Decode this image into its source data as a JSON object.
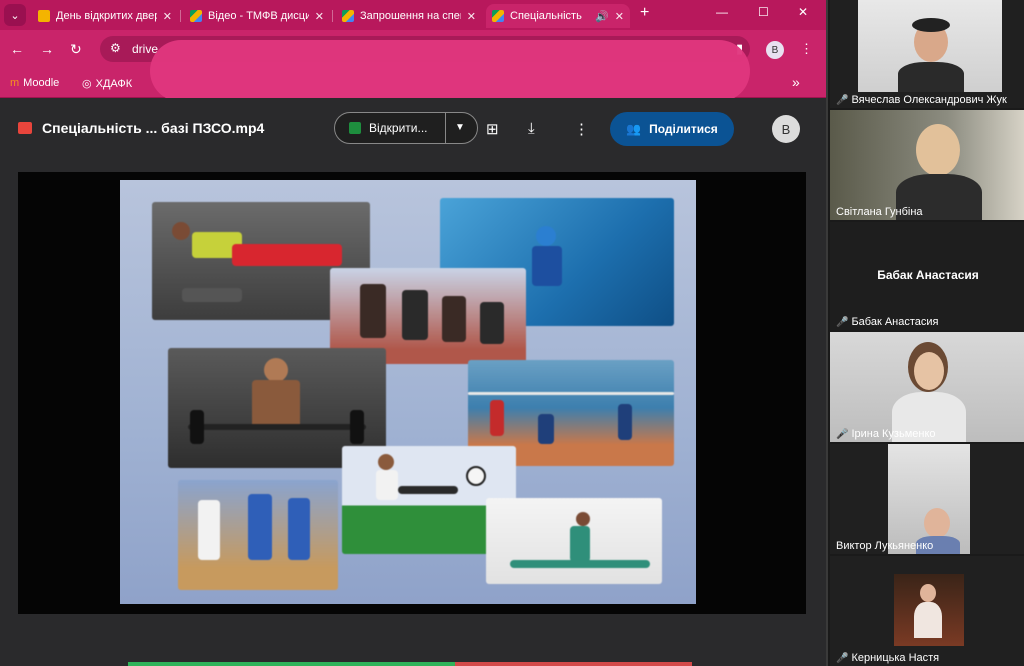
{
  "colors": {
    "tab_strip": "#b8185c",
    "toolbar": "#c9246a",
    "share_button": "#0b5394",
    "open_with_icon": "#1e8e3e",
    "mic_muted": "#e53935"
  },
  "browser": {
    "tabs": [
      {
        "title": "День відкритих дверей",
        "icon": "slides-icon",
        "active": false
      },
      {
        "title": "Відео - ТМФВ дисципліни",
        "icon": "drive-icon",
        "active": false
      },
      {
        "title": "Запрошення на спеціальність",
        "icon": "drive-icon",
        "active": false
      },
      {
        "title": "Спеціальність",
        "icon": "drive-icon",
        "active": true,
        "audio": "speaker-icon"
      }
    ],
    "url": "drive",
    "bookmarks": [
      {
        "label": "Moodle",
        "icon": "moodle-icon"
      },
      {
        "label": "ХДАФК",
        "icon": "globe-icon"
      }
    ],
    "profile_initial": "В"
  },
  "viewer": {
    "file_title": "Спеціальність ... базі ПЗСО.mp4",
    "open_with_label": "Відкрити...",
    "share_label": "Поділитися",
    "avatar_initial": "В"
  },
  "participants": [
    {
      "name": "Вячеслав Олександрович Жук",
      "muted": true,
      "video": true
    },
    {
      "name": "Світлана Гунбіна",
      "muted": false,
      "video": true
    },
    {
      "name": "Бабак Анастасия",
      "display_name": "Бабак Анастасия",
      "muted": true,
      "video": false
    },
    {
      "name": "Ірина Кузьменко",
      "muted": true,
      "video": true
    },
    {
      "name": "Виктор Лукьяненко",
      "muted": false,
      "video": true
    },
    {
      "name": "Керницька Настя",
      "muted": true,
      "video": true
    }
  ]
}
